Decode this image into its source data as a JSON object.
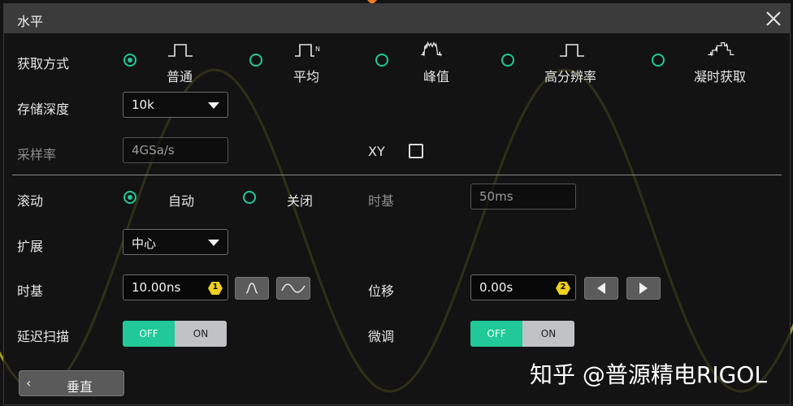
{
  "dialog": {
    "title": "水平"
  },
  "acquisition": {
    "label": "获取方式",
    "options": [
      {
        "label": "普通",
        "icon": "normal-acq-icon",
        "selected": true
      },
      {
        "label": "平均",
        "icon": "average-acq-icon",
        "selected": false,
        "icon_text": "N"
      },
      {
        "label": "峰值",
        "icon": "peak-acq-icon",
        "selected": false
      },
      {
        "label": "高分辨率",
        "icon": "high-res-acq-icon",
        "selected": false
      },
      {
        "label": "凝时获取",
        "icon": "ultra-acq-icon",
        "selected": false
      }
    ]
  },
  "memory_depth": {
    "label": "存储深度",
    "value": "10k"
  },
  "sample_rate": {
    "label": "采样率",
    "value": "4GSa/s"
  },
  "xy": {
    "label": "XY",
    "checked": false
  },
  "roll": {
    "label": "滚动",
    "options": [
      {
        "label": "自动",
        "selected": true
      },
      {
        "label": "关闭",
        "selected": false
      }
    ],
    "timebase_label": "时基",
    "timebase_value": "50ms"
  },
  "expand": {
    "label": "扩展",
    "value": "中心"
  },
  "timebase": {
    "label": "时基",
    "value": "10.00ns",
    "knob": "1"
  },
  "position": {
    "label": "位移",
    "value": "0.00s",
    "knob": "2"
  },
  "delayed_sweep": {
    "label": "延迟扫描",
    "off_label": "OFF",
    "on_label": "ON",
    "state": "OFF"
  },
  "fine_adjust": {
    "label": "微调",
    "off_label": "OFF",
    "on_label": "ON",
    "state": "OFF"
  },
  "back_button": {
    "label": "垂直"
  },
  "watermark": "知乎 @普源精电RIGOL",
  "colors": {
    "accent": "#20c997",
    "knob": "#f0d020",
    "trace": "#b9b52a",
    "background": "#131313"
  }
}
